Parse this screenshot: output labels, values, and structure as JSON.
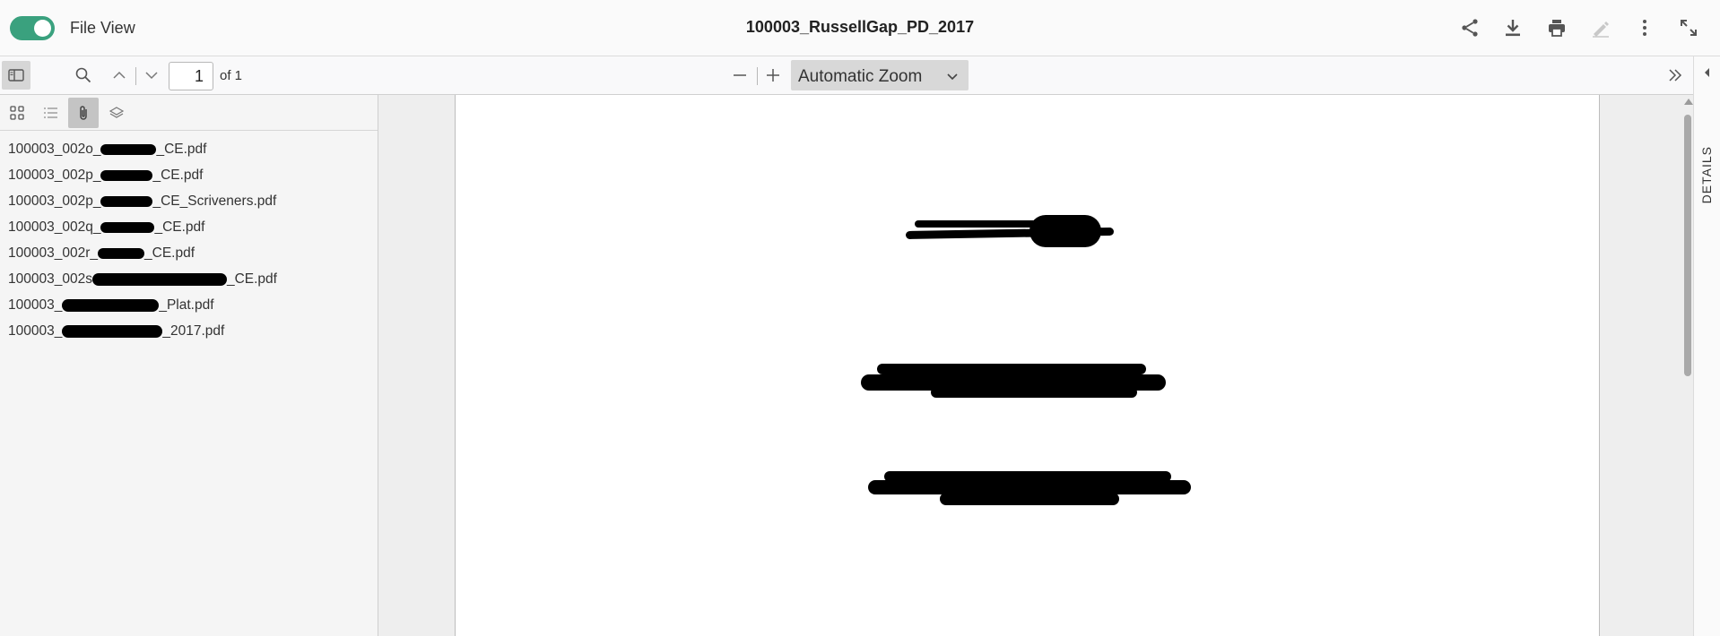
{
  "header": {
    "toggle_label": "File View",
    "toggle_on": true,
    "title": "100003_RussellGap_PD_2017",
    "icons": [
      "share-icon",
      "download-icon",
      "print-icon",
      "sign-icon",
      "more-vert-icon",
      "fullscreen-icon"
    ]
  },
  "toolbar": {
    "current_page": "1",
    "page_total": "of 1",
    "zoom": "Automatic Zoom"
  },
  "details": {
    "label": "DETAILS"
  },
  "sidebar": {
    "tabs": [
      "thumbnails-tab",
      "outline-tab",
      "attachments-tab",
      "layers-tab"
    ],
    "active_tab": "attachments-tab",
    "attachments": [
      {
        "prefix": "100003_002o_",
        "suffix": "_CE.pdf"
      },
      {
        "prefix": "100003_002p_",
        "suffix": "_CE.pdf"
      },
      {
        "prefix": "100003_002p_",
        "suffix": "_CE_Scriveners.pdf"
      },
      {
        "prefix": "100003_002q_",
        "suffix": "_CE.pdf"
      },
      {
        "prefix": "100003_002r_",
        "suffix": "_CE.pdf"
      },
      {
        "prefix": "100003_002s",
        "suffix": "_CE.pdf"
      },
      {
        "prefix": "100003_",
        "suffix": "_Plat.pdf"
      },
      {
        "prefix": "100003_",
        "suffix": "_2017.pdf"
      }
    ]
  },
  "colors": {
    "toggle": "#3aa17e",
    "page_text": "#8b1a1a"
  }
}
